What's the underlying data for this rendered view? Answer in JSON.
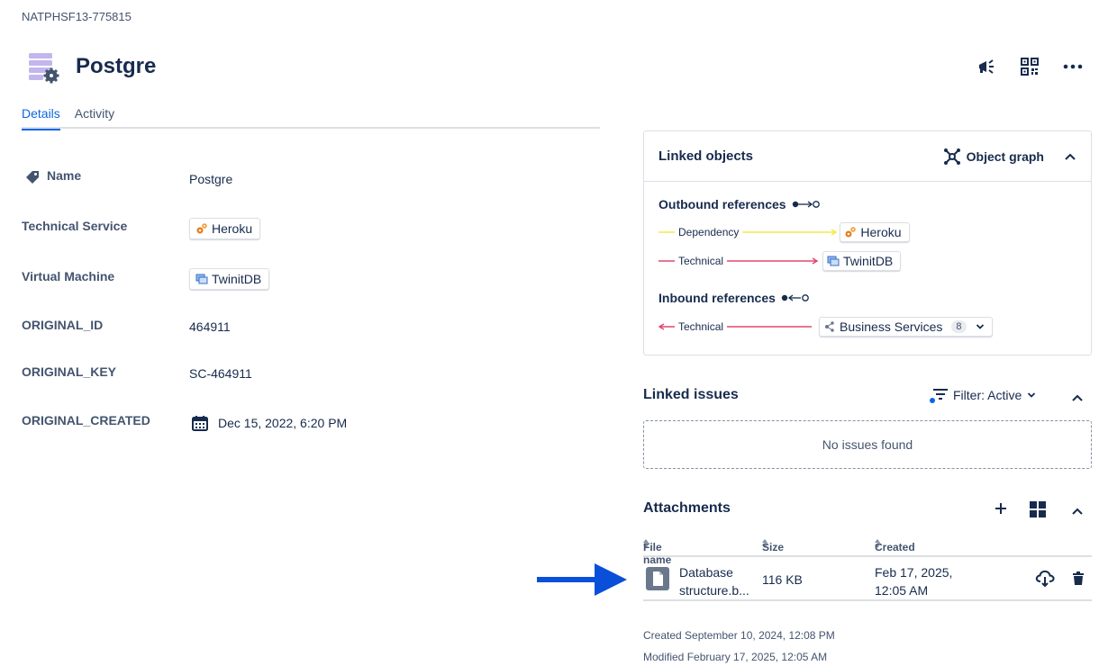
{
  "object": {
    "key": "NATPHSF13-775815",
    "title": "Postgre"
  },
  "tabs": [
    {
      "label": "Details",
      "active": true
    },
    {
      "label": "Activity",
      "active": false
    }
  ],
  "attributes": {
    "name": {
      "label": "Name",
      "value": "Postgre"
    },
    "technical_service": {
      "label": "Technical Service",
      "value": "Heroku"
    },
    "virtual_machine": {
      "label": "Virtual Machine",
      "value": "TwinitDB"
    },
    "original_id": {
      "label": "ORIGINAL_ID",
      "value": "464911"
    },
    "original_key": {
      "label": "ORIGINAL_KEY",
      "value": "SC-464911"
    },
    "original_created": {
      "label": "ORIGINAL_CREATED",
      "value": "Dec 15, 2022, 6:20 PM"
    }
  },
  "linked_objects": {
    "title": "Linked objects",
    "graph_button": "Object graph",
    "outbound_title": "Outbound references",
    "outbound": [
      {
        "type": "Dependency",
        "target": "Heroku",
        "color": "#f5e94a"
      },
      {
        "type": "Technical",
        "target": "TwinitDB",
        "color": "#e2486f"
      }
    ],
    "inbound_title": "Inbound references",
    "inbound": [
      {
        "type": "Technical",
        "target": "Business Services",
        "count": "8",
        "color": "#e2486f"
      }
    ]
  },
  "linked_issues": {
    "title": "Linked issues",
    "filter_label": "Filter: Active",
    "empty_text": "No issues found"
  },
  "attachments": {
    "title": "Attachments",
    "columns": [
      "File name",
      "Size",
      "Created"
    ],
    "rows": [
      {
        "file_line1": "Database",
        "file_line2": "structure.b...",
        "size": "116 KB",
        "created_line1": "Feb 17, 2025,",
        "created_line2": "12:05 AM"
      }
    ]
  },
  "meta": {
    "created": "Created September 10, 2024, 12:08 PM",
    "modified": "Modified February 17, 2025, 12:05 AM"
  },
  "colors": {
    "accent": "#0c66e4",
    "annotation_arrow": "#0a4fd9",
    "text": "#172b4d"
  }
}
